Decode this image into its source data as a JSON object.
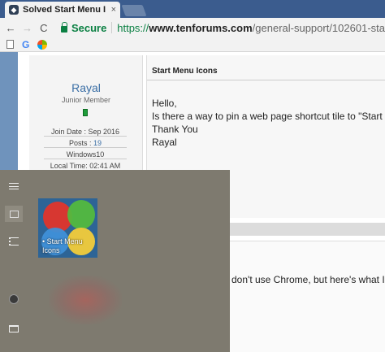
{
  "browser": {
    "tab": {
      "title": "Solved Start Menu I",
      "close": "×"
    },
    "nav": {
      "back": "←",
      "forward": "→",
      "reload": "C"
    },
    "address": {
      "secure_label": "Secure",
      "separator": "|",
      "scheme": "https://",
      "host": "www.tenforums.com",
      "path": "/general-support/102601-sta"
    },
    "bookmarks": {
      "g_label": "G"
    }
  },
  "user": {
    "name": "Rayal",
    "rank": "Junior Member",
    "join_date": "Join Date : Sep 2016",
    "posts_label": "Posts : ",
    "posts_count": "19",
    "os": "Windows10",
    "local_time": "Local Time: 02:41 AM"
  },
  "post": {
    "title": "Start Menu Icons",
    "lines": [
      "Hello,",
      "Is there a way to pin a web page shortcut tile to \"Start M",
      "Thank You",
      "Rayal"
    ]
  },
  "reply": {
    "text": "don't use Chrome, but here's what I fo"
  },
  "start_menu": {
    "tile": {
      "label": "• Start Menu Icons"
    },
    "colors": {
      "background": "#7e7a6f",
      "tile_bg": "#2d6496"
    }
  },
  "colors": {
    "secure_green": "#0b8043",
    "link_blue": "#3a6ea5",
    "tabstrip": "#3b5c8e"
  }
}
